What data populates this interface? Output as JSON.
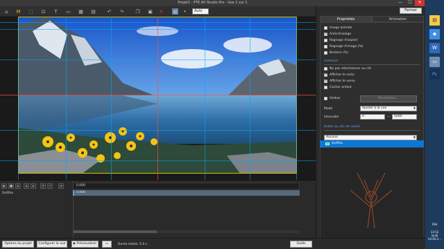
{
  "window": {
    "title": "Projet1 - PTE AV Studio Pro - Vue 1 sur 1",
    "minimize": "—",
    "maximize": "☐",
    "close": "✕"
  },
  "toolbar": {
    "zoom": "Auto"
  },
  "panel": {
    "close_label": "Fermer",
    "tabs": [
      "Propriétés",
      "Animation"
    ],
    "checkboxes_top": [
      {
        "label": "Image animée",
        "checked": false
      },
      {
        "label": "Anticrénelage",
        "checked": true
      },
      {
        "label": "Rognage d'aspect",
        "checked": false
      },
      {
        "label": "Rognage d'image (%)",
        "checked": false
      },
      {
        "label": "Bordure (%)",
        "checked": false
      }
    ],
    "section_common": "Commun",
    "checkboxes_common": [
      {
        "label": "Ne pas sélectionner au clic",
        "checked": false
      },
      {
        "label": "Afficher le recto",
        "checked": true
      },
      {
        "label": "Afficher le verso",
        "checked": true
      },
      {
        "label": "Cacher enfant",
        "checked": false
      }
    ],
    "shadow": {
      "label": "Ombre",
      "checked": false,
      "button": "Paramètres..."
    },
    "mode": {
      "label": "Mode",
      "value": "Ajuster à la vue"
    },
    "interval": {
      "label": "Intervalle",
      "from": "0",
      "to": "5000",
      "sep": "—"
    },
    "section_click": "Action au clic de souris",
    "click_action": "Aucune",
    "object_list": [
      "Sn/Rha"
    ]
  },
  "timeline": {
    "ruler_value": "0.000",
    "track_label": "Sn/Rha",
    "clip_value": "0.000"
  },
  "bottombar": {
    "options_project": "Options du projet",
    "configure_view": "Configurer la vue",
    "preview": "Prévisualiser",
    "duration": "Durée totale: 5.0 s",
    "tools": "Outils"
  },
  "taskbar": {
    "lang": "FRA",
    "time": "13:52",
    "day": "lundi",
    "date": "14-02-2..."
  },
  "colors": {
    "accent": "#0a78d7",
    "selection_border": "#d9c200",
    "guide": "#00aaff"
  }
}
